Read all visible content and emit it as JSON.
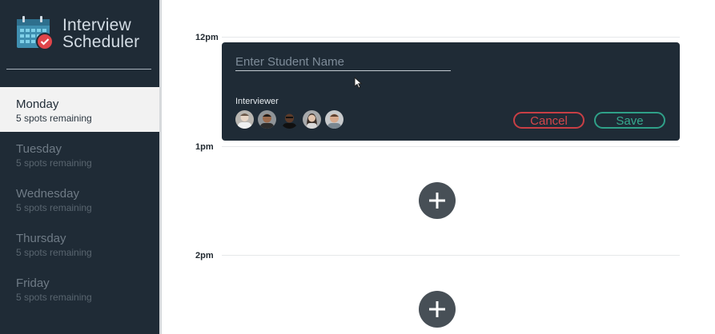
{
  "app": {
    "title_line1": "Interview",
    "title_line2": "Scheduler",
    "logo_icon": "calendar-check-icon"
  },
  "sidebar": {
    "days": [
      {
        "name": "Monday",
        "spots": "5 spots remaining",
        "selected": true
      },
      {
        "name": "Tuesday",
        "spots": "5 spots remaining",
        "selected": false
      },
      {
        "name": "Wednesday",
        "spots": "5 spots remaining",
        "selected": false
      },
      {
        "name": "Thursday",
        "spots": "5 spots remaining",
        "selected": false
      },
      {
        "name": "Friday",
        "spots": "5 spots remaining",
        "selected": false
      }
    ]
  },
  "schedule": {
    "slots": [
      {
        "time": "12pm"
      },
      {
        "time": "1pm"
      },
      {
        "time": "2pm"
      }
    ],
    "add_icon": "plus-icon"
  },
  "form": {
    "student_name_value": "",
    "student_name_placeholder": "Enter Student Name",
    "interviewer_label": "Interviewer",
    "interviewers": [
      "avatar-1",
      "avatar-2",
      "avatar-3",
      "avatar-4",
      "avatar-5"
    ],
    "cancel_label": "Cancel",
    "save_label": "Save"
  },
  "colors": {
    "sidebar_bg": "#1f2b36",
    "selected_bg": "#f2f2f2",
    "cancel": "#c83f45",
    "save": "#2fa088",
    "add_button": "#474f56"
  }
}
